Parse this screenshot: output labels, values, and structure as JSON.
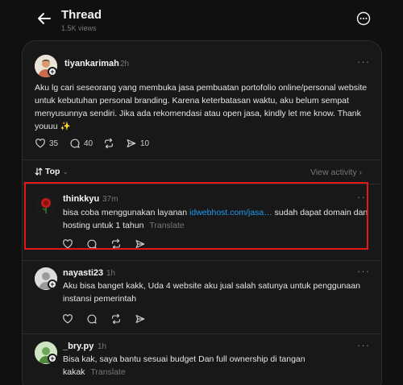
{
  "header": {
    "title": "Thread",
    "views": "1.5K views"
  },
  "post": {
    "username": "tiyankarimah",
    "time": "2h",
    "text": "Aku lg cari seseorang yang membuka jasa pembuatan portofolio online/personal website untuk kebutuhan personal branding. Karena keterbatasan waktu, aku belum sempat menyusunnya sendiri. Jika ada rekomendasi atau open jasa, kindly let me know. Thank youuu ✨",
    "likes": "35",
    "comments": "40",
    "shares": "10"
  },
  "sort": {
    "label": "Top",
    "view_activity": "View activity"
  },
  "replies": [
    {
      "username": "thinkkyu",
      "time": "37m",
      "text_before": "bisa coba menggunakan layanan ",
      "link": "idwebhost.com/jasa…",
      "text_after": " sudah dapat domain dan hosting untuk 1 tahun",
      "translate": "Translate"
    },
    {
      "username": "nayasti23",
      "time": "1h",
      "text": "Aku bisa banget kakk, Uda 4 website aku jual salah satunya untuk penggunaan instansi pemerintah"
    },
    {
      "username": "_bry.py",
      "time": "1h",
      "text": "Bisa kak, saya bantu sesuai budget Dan full ownership di tangan kakak",
      "translate": "Translate"
    }
  ],
  "colors": {
    "background": "#101010",
    "panel": "#181818",
    "link": "#1d9bf0",
    "highlight": "#e01818"
  }
}
